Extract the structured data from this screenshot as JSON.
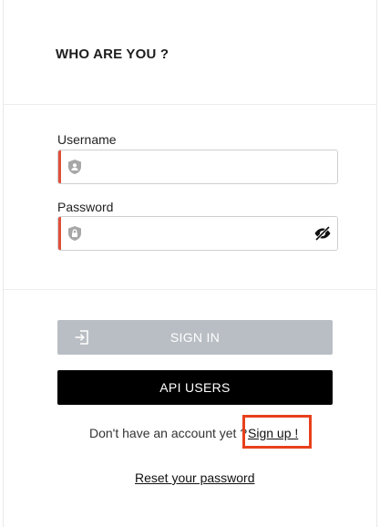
{
  "header": {
    "title": "WHO ARE YOU ?"
  },
  "form": {
    "username": {
      "label": "Username",
      "value": "",
      "placeholder": ""
    },
    "password": {
      "label": "Password",
      "value": "",
      "placeholder": ""
    }
  },
  "buttons": {
    "sign_in": "SIGN IN",
    "api_users": "API USERS"
  },
  "signup": {
    "prompt": "Don't have an account yet ?",
    "link": "Sign up !"
  },
  "reset": {
    "link": "Reset your password"
  },
  "colors": {
    "accent_red": "#e0503a",
    "highlight_box": "#e8401c",
    "sign_in_bg": "#b9bec4",
    "api_bg": "#000000"
  },
  "icons": {
    "username": "user-shield-icon",
    "password": "lock-shield-icon",
    "toggle": "eye-slash-icon",
    "sign_in": "login-arrow-icon"
  }
}
